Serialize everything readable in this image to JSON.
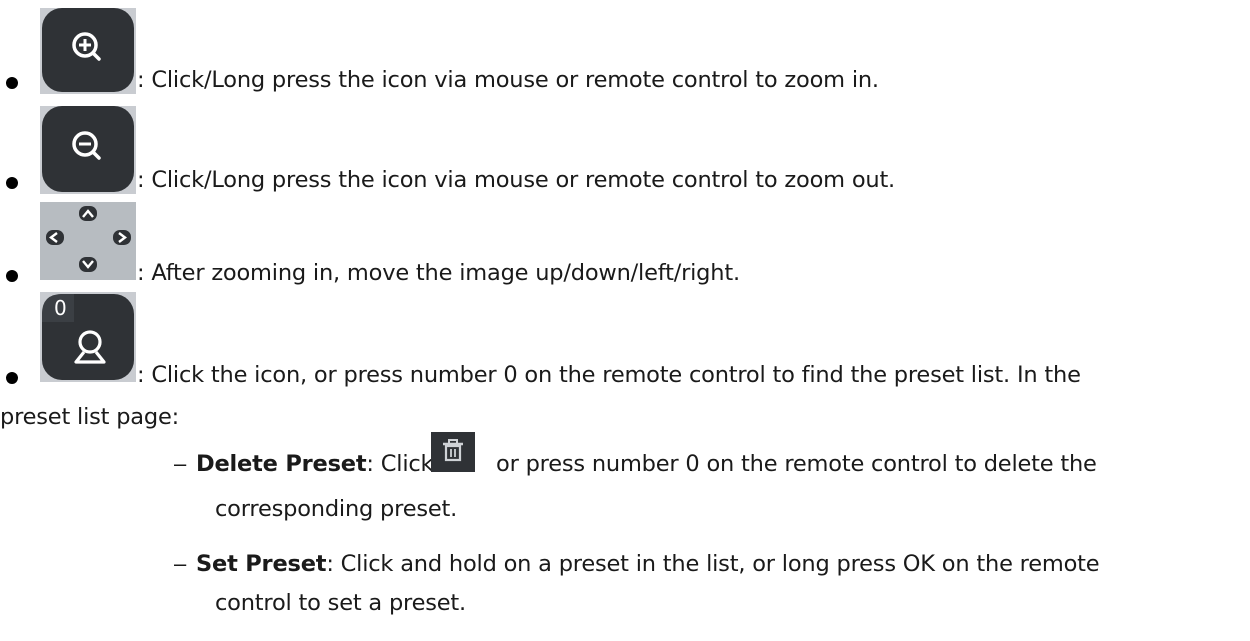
{
  "items": [
    {
      "icon": "zoom-in-icon",
      "text": ": Click/Long press the icon via mouse or remote control to zoom in."
    },
    {
      "icon": "zoom-out-icon",
      "text": ": Click/Long press the icon via mouse or remote control to zoom out."
    },
    {
      "icon": "direction-pad-icon",
      "text": ": After zooming in, move the image up/down/left/right."
    },
    {
      "icon": "preset-icon",
      "icon_badge": "0",
      "text": ": Click the icon, or press number 0 on the remote control to find the preset list. In the",
      "text_cont": "preset list page:"
    }
  ],
  "subitems": [
    {
      "bullet": "–",
      "term": "Delete Preset",
      "text_a": ": Click",
      "icon": "trash-icon",
      "text_b": "or press number 0 on the remote control to delete the",
      "text_cont": "corresponding preset."
    },
    {
      "bullet": "–",
      "term": "Set Preset",
      "text_a": ": Click and hold on a preset in the list, or long press OK on the remote",
      "text_cont": "control to set a preset."
    }
  ],
  "colors": {
    "icon_dark": "#2f3236",
    "icon_frame": "#c8cbd0",
    "text": "#1a1a1a"
  }
}
